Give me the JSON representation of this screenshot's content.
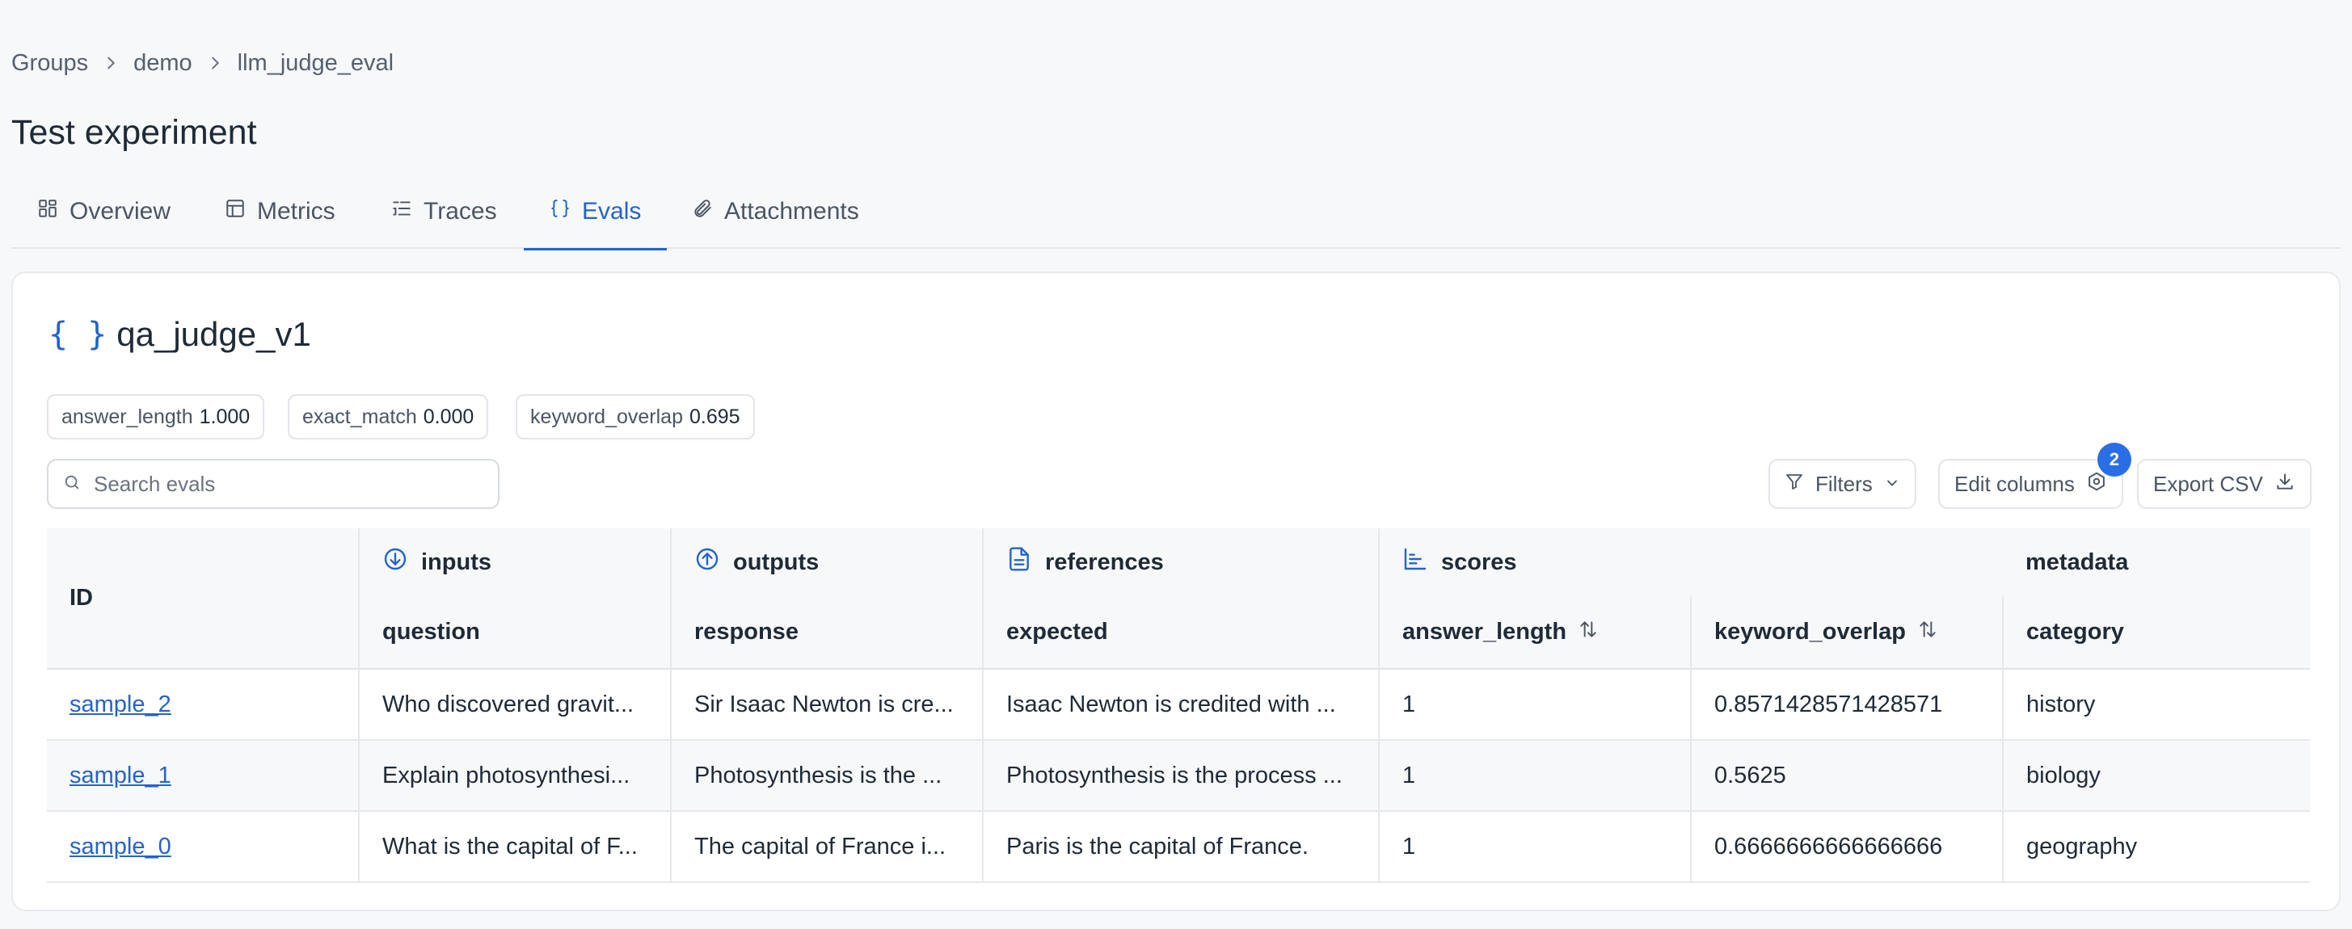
{
  "breadcrumb": {
    "items": [
      "Groups",
      "demo",
      "llm_judge_eval"
    ]
  },
  "page": {
    "title": "Test experiment"
  },
  "tabs": [
    {
      "label": "Overview",
      "icon": "grid-icon"
    },
    {
      "label": "Metrics",
      "icon": "table-icon"
    },
    {
      "label": "Traces",
      "icon": "list-tree-icon"
    },
    {
      "label": "Evals",
      "icon": "braces-icon",
      "active": true
    },
    {
      "label": "Attachments",
      "icon": "paperclip-icon"
    }
  ],
  "eval": {
    "title": "qa_judge_v1",
    "braces": "{ }",
    "chips": [
      {
        "label": "answer_length",
        "value": "1.000"
      },
      {
        "label": "exact_match",
        "value": "0.000"
      },
      {
        "label": "keyword_overlap",
        "value": "0.695"
      }
    ]
  },
  "search": {
    "placeholder": "Search evals",
    "value": ""
  },
  "toolbar": {
    "filters_label": "Filters",
    "edit_columns_label": "Edit columns",
    "edit_columns_badge": "2",
    "export_label": "Export CSV"
  },
  "table": {
    "id_header": "ID",
    "groups": {
      "inputs": "inputs",
      "outputs": "outputs",
      "references": "references",
      "scores": "scores",
      "metadata": "metadata"
    },
    "subheaders": {
      "question": "question",
      "response": "response",
      "expected": "expected",
      "answer_length": "answer_length",
      "keyword_overlap": "keyword_overlap",
      "category": "category"
    },
    "rows": [
      {
        "id": "sample_2",
        "question": "Who discovered gravit...",
        "response": "Sir Isaac Newton is cre...",
        "expected": "Isaac Newton is credited with ...",
        "answer_length": "1",
        "keyword_overlap": "0.8571428571428571",
        "category": "history"
      },
      {
        "id": "sample_1",
        "question": "Explain photosynthesi...",
        "response": "Photosynthesis is the ...",
        "expected": "Photosynthesis is the process ...",
        "answer_length": "1",
        "keyword_overlap": "0.5625",
        "category": "biology"
      },
      {
        "id": "sample_0",
        "question": "What is the capital of F...",
        "response": "The capital of France i...",
        "expected": "Paris is the capital of France.",
        "answer_length": "1",
        "keyword_overlap": "0.6666666666666666",
        "category": "geography"
      }
    ]
  },
  "colors": {
    "accent": "#2563c9",
    "badge": "#2a6ee6"
  }
}
